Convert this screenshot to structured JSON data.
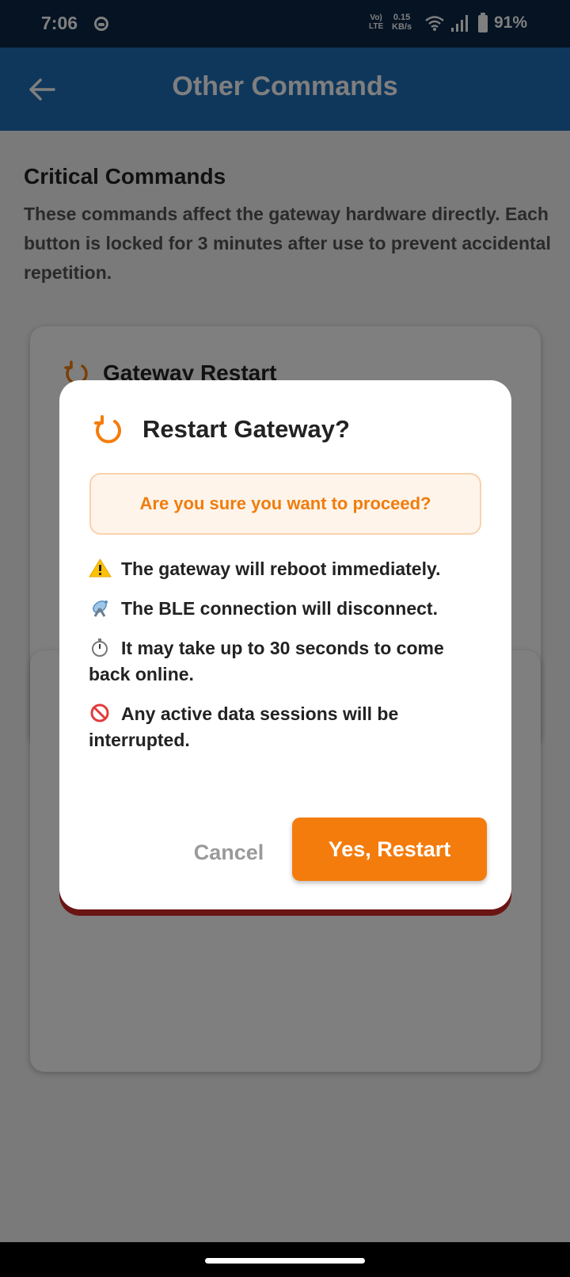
{
  "status_bar": {
    "time": "7:06",
    "volte_line1": "Vo)",
    "volte_line2": "LTE",
    "speed_value": "0.15",
    "speed_unit": "KB/s",
    "battery": "91%"
  },
  "app_bar": {
    "title": "Other Commands",
    "color": "#1f6fb8"
  },
  "section": {
    "title": "Critical Commands",
    "description": "These commands affect the gateway hardware directly. Each button is locked for 3 minutes after use to prevent accidental repetition."
  },
  "cards": [
    {
      "title": "Gateway Restart",
      "icon": "restart-icon"
    }
  ],
  "dialog": {
    "title": "Restart Gateway?",
    "icon": "restart-icon",
    "warning": "Are you sure you want to proceed?",
    "bullets": [
      {
        "icon": "warning-icon",
        "text": "The gateway will reboot immediately."
      },
      {
        "icon": "antenna-icon",
        "text": "The BLE connection will disconnect."
      },
      {
        "icon": "stopwatch-icon",
        "text": "It may take up to 30 seconds to come back online."
      },
      {
        "icon": "prohibited-icon",
        "text": "Any active data sessions will be interrupted."
      }
    ],
    "cancel_label": "Cancel",
    "confirm_label": "Yes, Restart",
    "accent": "#f47c0c"
  }
}
